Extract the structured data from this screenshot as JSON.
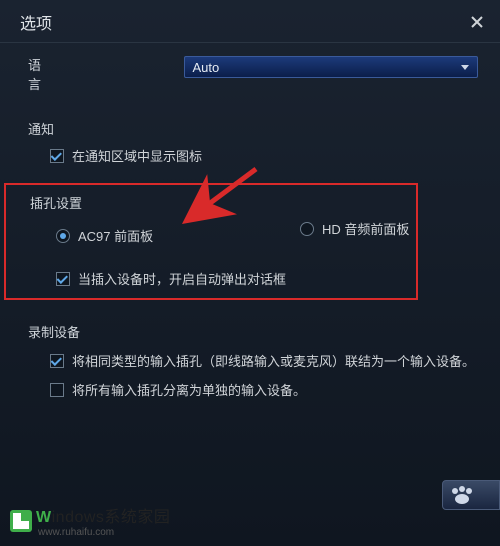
{
  "titlebar": {
    "title": "选项"
  },
  "language": {
    "label": "语言",
    "selected": "Auto"
  },
  "notification": {
    "label": "通知",
    "show_icon_checked": true,
    "show_icon_label": "在通知区域中显示图标"
  },
  "jack": {
    "label": "插孔设置",
    "ac97_selected": true,
    "ac97_label": "AC97 前面板",
    "hd_selected": false,
    "hd_label": "HD 音频前面板",
    "auto_popup_checked": true,
    "auto_popup_label": "当插入设备时，开启自动弹出对话框"
  },
  "recording": {
    "label": "录制设备",
    "merge_checked": true,
    "merge_label": "将相同类型的输入插孔（即线路输入或麦克风）联结为一个输入设备。",
    "separate_checked": false,
    "separate_label": "将所有输入插孔分离为单独的输入设备。"
  },
  "watermark": {
    "brand_first": "W",
    "brand_rest": "indows系统家园",
    "url": "www.ruhaifu.com"
  }
}
